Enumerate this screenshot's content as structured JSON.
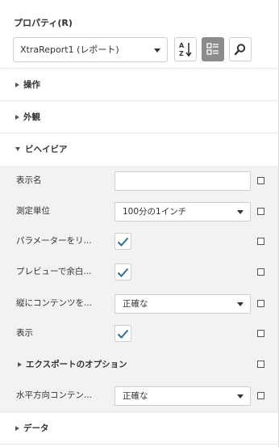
{
  "panel": {
    "title": "プロパティ(R)",
    "component_select": {
      "value": "XtraReport1 (レポート)"
    },
    "toolbar": {
      "sort_alpha_icon": "sort-alphabetical-icon",
      "categories_icon": "categorized-view-icon",
      "search_icon": "search-icon"
    }
  },
  "sections": {
    "actions": {
      "label": "操作"
    },
    "appearance": {
      "label": "外観"
    },
    "behavior": {
      "label": "ビヘイビア"
    },
    "data": {
      "label": "データ"
    }
  },
  "behavior": {
    "rows": [
      {
        "label": "表示名",
        "value": ""
      },
      {
        "label": "測定単位",
        "value": "100分の1インチ"
      },
      {
        "label": "パラメーターをリ...",
        "checked": true
      },
      {
        "label": "プレビューで余白...",
        "checked": true
      },
      {
        "label": "縦にコンテンツを...",
        "value": "正確な"
      },
      {
        "label": "表示",
        "checked": true
      },
      {
        "label": "エクスポートのオプション"
      },
      {
        "label": "水平方向コンテン...",
        "value": "正確な"
      }
    ]
  },
  "colors": {
    "active_button": "#8c8c8c",
    "behavior_background": "#f2f2f2",
    "check_color": "#2b6c9e"
  }
}
